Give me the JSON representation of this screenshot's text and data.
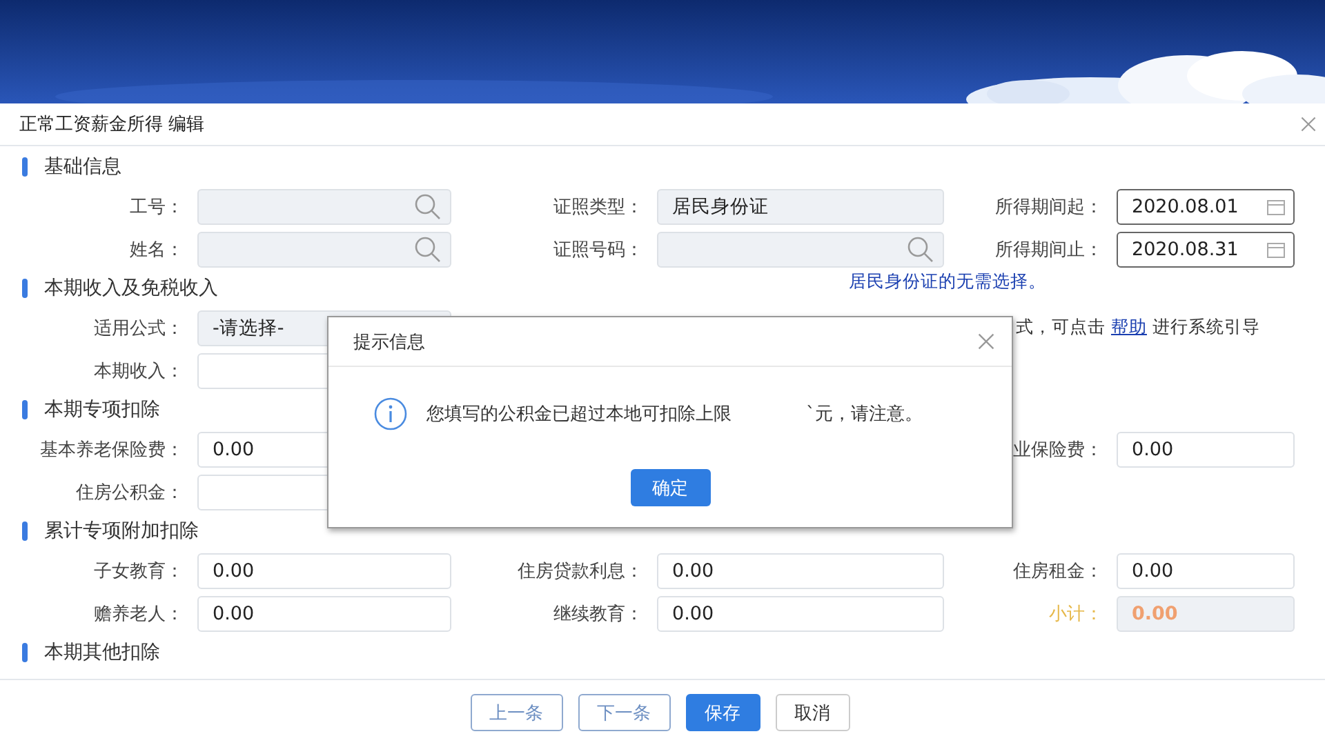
{
  "panel": {
    "title": "正常工资薪金所得 编辑"
  },
  "sections": [
    {
      "title": "基础信息",
      "rows": [
        [
          {
            "label": "工号：",
            "kind": "search"
          },
          {
            "label": "证照类型：",
            "kind": "readonly",
            "value": "居民身份证"
          },
          {
            "label": "所得期间起：",
            "kind": "date",
            "value": "2020.08.01"
          }
        ],
        [
          {
            "label": "姓名：",
            "kind": "search"
          },
          {
            "label": "证照号码：",
            "kind": "search"
          },
          {
            "label": "所得期间止：",
            "kind": "date",
            "value": "2020.08.31"
          }
        ]
      ]
    },
    {
      "title": "本期收入及免税收入",
      "note": "居民身份证的无需选择。",
      "rows": [
        [
          {
            "label": "适用公式：",
            "kind": "select",
            "value": "-请选择-"
          },
          {
            "kind": "gap"
          },
          {
            "kind": "note",
            "before": "式，可点击",
            "link": "帮助",
            "after": "进行系统引导"
          }
        ],
        [
          {
            "label": "本期收入：",
            "kind": "text"
          }
        ]
      ]
    },
    {
      "title": "本期专项扣除",
      "rows": [
        [
          {
            "label": "基本养老保险费：",
            "kind": "text",
            "value": "0.00"
          },
          {
            "kind": "gap"
          },
          {
            "label": "业保险费：",
            "kind": "text",
            "value": "0.00"
          }
        ],
        [
          {
            "label": "住房公积金：",
            "kind": "text"
          }
        ]
      ]
    },
    {
      "title": "累计专项附加扣除",
      "rows": [
        [
          {
            "label": "子女教育：",
            "kind": "text",
            "value": "0.00"
          },
          {
            "label": "住房贷款利息：",
            "kind": "text",
            "value": "0.00"
          },
          {
            "label": "住房租金：",
            "kind": "text",
            "value": "0.00"
          }
        ],
        [
          {
            "label": "赡养老人：",
            "kind": "text",
            "value": "0.00"
          },
          {
            "label": "继续教育：",
            "kind": "text",
            "value": "0.00"
          },
          {
            "label": "小计：",
            "kind": "total",
            "value": "0.00"
          }
        ]
      ]
    },
    {
      "title": "本期其他扣除"
    }
  ],
  "footer_buttons": [
    {
      "label": "上一条",
      "kind": "outline"
    },
    {
      "label": "下一条",
      "kind": "outline"
    },
    {
      "label": "保存",
      "kind": "primary"
    },
    {
      "label": "取消",
      "kind": "plain"
    }
  ],
  "dialog": {
    "title": "提示信息",
    "message": "您填写的公积金已超过本地可扣除上限",
    "message_tail": "`元，请注意。",
    "button": "确定"
  }
}
